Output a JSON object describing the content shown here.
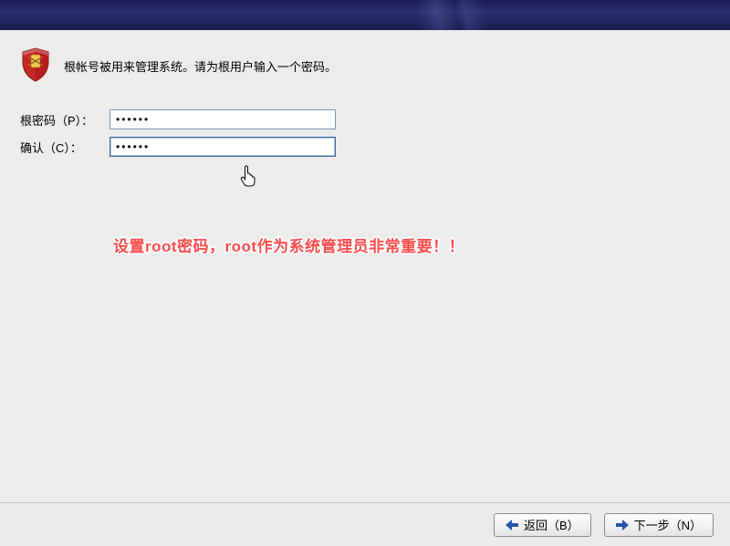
{
  "intro": "根帐号被用来管理系统。请为根用户输入一个密码。",
  "fields": {
    "password": {
      "label": "根密码（P）：",
      "value": "••••••"
    },
    "confirm": {
      "label": "确认（C）：",
      "value": "••••••"
    }
  },
  "annotation": "设置root密码，root作为系统管理员非常重要！！",
  "buttons": {
    "back": "返回（B）",
    "next": "下一步（N）"
  },
  "colors": {
    "arrow": "#2956a6"
  }
}
